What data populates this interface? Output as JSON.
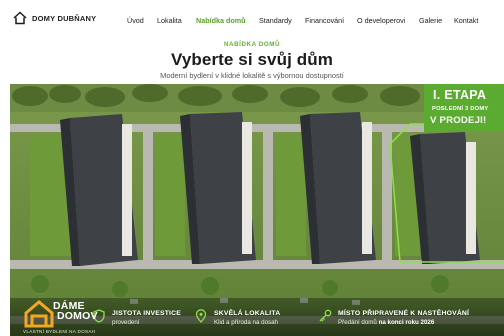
{
  "header": {
    "logo_text": "DOMY DUBŇANY",
    "nav": [
      {
        "label": "Úvod"
      },
      {
        "label": "Lokalita"
      },
      {
        "label": "Nabídka domů",
        "active": true
      },
      {
        "label": "Standardy"
      },
      {
        "label": "Financování"
      },
      {
        "label": "O developerovi"
      },
      {
        "label": "Galerie"
      },
      {
        "label": "Kontakt"
      }
    ]
  },
  "hero": {
    "eyebrow": "NABÍDKA DOMŮ",
    "title": "Vyberte si svůj dům",
    "subtitle": "Moderní bydlení v klidné lokalitě s výbornou dostupností"
  },
  "badge": {
    "title": "I. ETAPA",
    "subtitle": "POSLEDNÍ 3 DOMY",
    "main": "V PRODEJI!"
  },
  "brand": {
    "line1": "DÁME",
    "line2": "DOMOV",
    "tagline": "VLASTNÍ BYDLENÍ NA DOSAH"
  },
  "info": [
    {
      "title": "JISTOTA INVESTICE",
      "text": "provedení",
      "icon": "shield-icon"
    },
    {
      "title": "SKVĚLÁ LOKALITA",
      "text": "Klid a příroda na dosah",
      "icon": "map-pin-icon"
    },
    {
      "title": "MÍSTO PŘIPRAVENÉ K NASTĚHOVÁNÍ",
      "text_prefix": "Předání domů ",
      "text_bold": "na konci roku 2026",
      "icon": "key-icon"
    }
  ],
  "colors": {
    "accent": "#5aab2f",
    "nav_active": "#5aa12c"
  }
}
